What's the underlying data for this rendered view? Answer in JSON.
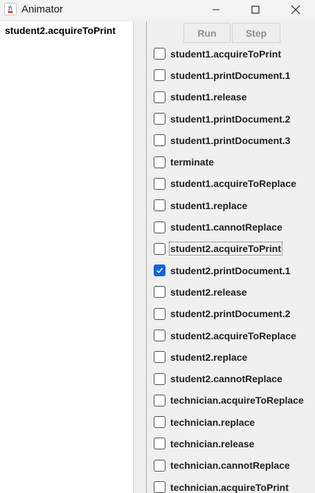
{
  "window": {
    "title": "Animator",
    "accent": "#1366d6"
  },
  "toolbar": {
    "run_label": "Run",
    "step_label": "Step"
  },
  "history": {
    "items": [
      "student2.acquireToPrint"
    ]
  },
  "events": [
    {
      "label": "student1.acquireToPrint",
      "checked": false
    },
    {
      "label": "student1.printDocument.1",
      "checked": false
    },
    {
      "label": "student1.release",
      "checked": false
    },
    {
      "label": "student1.printDocument.2",
      "checked": false
    },
    {
      "label": "student1.printDocument.3",
      "checked": false
    },
    {
      "label": "terminate",
      "checked": false
    },
    {
      "label": "student1.acquireToReplace",
      "checked": false
    },
    {
      "label": "student1.replace",
      "checked": false
    },
    {
      "label": "student1.cannotReplace",
      "checked": false
    },
    {
      "label": "student2.acquireToPrint",
      "checked": false,
      "focused": true
    },
    {
      "label": "student2.printDocument.1",
      "checked": true
    },
    {
      "label": "student2.release",
      "checked": false
    },
    {
      "label": "student2.printDocument.2",
      "checked": false
    },
    {
      "label": "student2.acquireToReplace",
      "checked": false
    },
    {
      "label": "student2.replace",
      "checked": false
    },
    {
      "label": "student2.cannotReplace",
      "checked": false
    },
    {
      "label": "technician.acquireToReplace",
      "checked": false
    },
    {
      "label": "technician.replace",
      "checked": false
    },
    {
      "label": "technician.release",
      "checked": false
    },
    {
      "label": "technician.cannotReplace",
      "checked": false
    },
    {
      "label": "technician.acquireToPrint",
      "checked": false
    }
  ]
}
